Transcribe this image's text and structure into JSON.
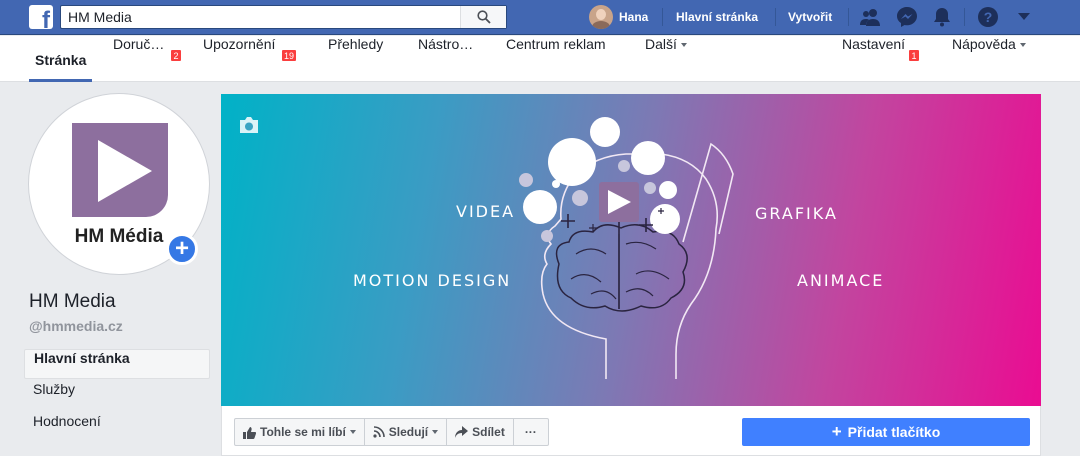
{
  "topbar": {
    "search_value": "HM Media",
    "user_name": "Hana",
    "home_label": "Hlavní stránka",
    "create_label": "Vytvořit"
  },
  "subnav": {
    "items": [
      {
        "label": "Stránka"
      },
      {
        "label": "Doruč…",
        "badge": "2"
      },
      {
        "label": "Upozornění",
        "badge": "19"
      },
      {
        "label": "Přehledy"
      },
      {
        "label": "Nástro…"
      },
      {
        "label": "Centrum reklam"
      },
      {
        "label": "Další"
      }
    ],
    "settings_label": "Nastavení",
    "settings_badge": "1",
    "help_label": "Nápověda"
  },
  "profile": {
    "logo_text": "HM Média",
    "page_name": "HM Media",
    "handle": "@hmmedia.cz"
  },
  "sidebar": {
    "items": [
      {
        "label": "Hlavní stránka"
      },
      {
        "label": "Služby"
      },
      {
        "label": "Hodnocení"
      }
    ]
  },
  "cover": {
    "labels": {
      "videa": "Videa",
      "grafika": "Grafika",
      "motion": "Motion design",
      "animace": "Animace"
    }
  },
  "actions": {
    "like_label": "Tohle se mi líbí",
    "follow_label": "Sledují",
    "share_label": "Sdílet",
    "more_label": "···",
    "add_button_label": "Přidat tlačítko"
  },
  "colors": {
    "brand_blue": "#4267b2",
    "button_blue": "#4080ff",
    "badge_red": "#fa3e3e",
    "logo_purple": "#8d6f9e"
  }
}
